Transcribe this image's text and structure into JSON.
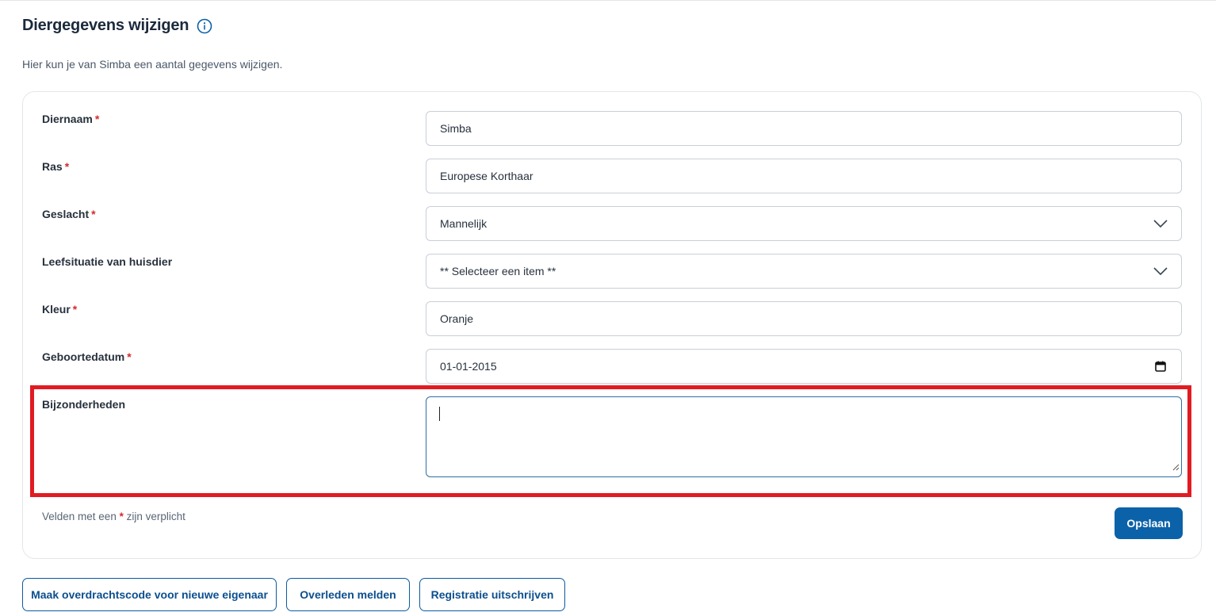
{
  "page": {
    "title": "Diergegevens wijzigen",
    "intro": "Hier kun je van Simba een aantal gegevens wijzigen."
  },
  "form": {
    "required_marker": "*",
    "fields": [
      {
        "label": "Diernaam",
        "required": true,
        "type": "text",
        "value": "Simba"
      },
      {
        "label": "Ras",
        "required": true,
        "type": "text",
        "value": "Europese Korthaar"
      },
      {
        "label": "Geslacht",
        "required": true,
        "type": "select",
        "value": "Mannelijk"
      },
      {
        "label": "Leefsituatie van huisdier",
        "required": false,
        "type": "select",
        "value": "** Selecteer een item **"
      },
      {
        "label": "Kleur",
        "required": true,
        "type": "text",
        "value": "Oranje"
      },
      {
        "label": "Geboortedatum",
        "required": true,
        "type": "date",
        "value": "01-01-2015"
      },
      {
        "label": "Bijzonderheden",
        "required": false,
        "type": "textarea",
        "value": ""
      }
    ],
    "footnote_before": "Velden met een",
    "footnote_after": "zijn verplicht",
    "save_label": "Opslaan"
  },
  "actions": {
    "transfer_label": "Maak overdrachtscode voor nieuwe eigenaar",
    "deceased_label": "Overleden melden",
    "unregister_label": "Registratie uitschrijven"
  },
  "colors": {
    "primary": "#0b62a8",
    "required": "#d42a2a",
    "highlight": "#e11b22",
    "focus_border": "#2d6fa6"
  },
  "icons": {
    "title_info": "info-icon",
    "select": "chevron-down-icon",
    "date": "calendar-icon",
    "textarea": "resize-handle-icon"
  }
}
